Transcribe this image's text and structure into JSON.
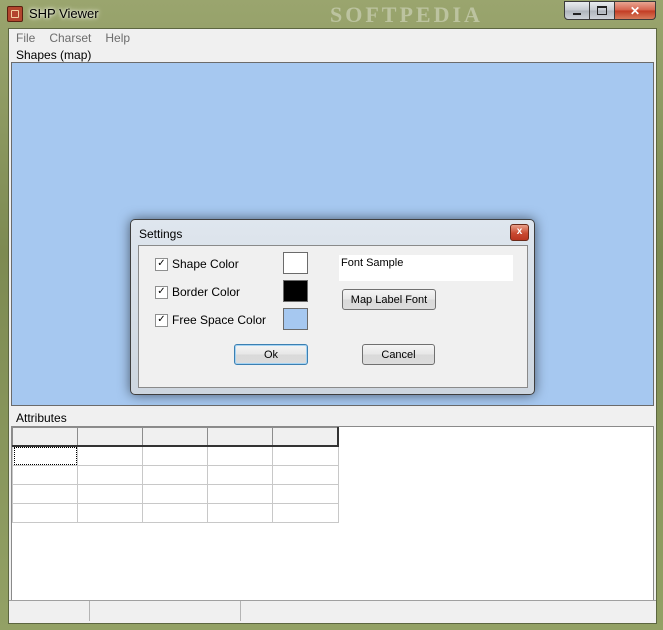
{
  "window": {
    "title": "SHP Viewer",
    "watermark": "SOFTPEDIA"
  },
  "menu": [
    "File",
    "Charset",
    "Help"
  ],
  "shapes_panel": {
    "label": "Shapes (map)",
    "background": "#a6c8f0"
  },
  "attributes_panel": {
    "label": "Attributes"
  },
  "settings_dialog": {
    "title": "Settings",
    "close_glyph": "x",
    "options": [
      {
        "label": "Shape Color",
        "checked": true,
        "color": "#ffffff"
      },
      {
        "label": "Border Color",
        "checked": true,
        "color": "#000000"
      },
      {
        "label": "Free Space Color",
        "checked": true,
        "color": "#a6c8f0"
      }
    ],
    "font_sample": "Font Sample",
    "map_label_font_button": "Map Label Font",
    "ok_button": "Ok",
    "cancel_button": "Cancel"
  }
}
